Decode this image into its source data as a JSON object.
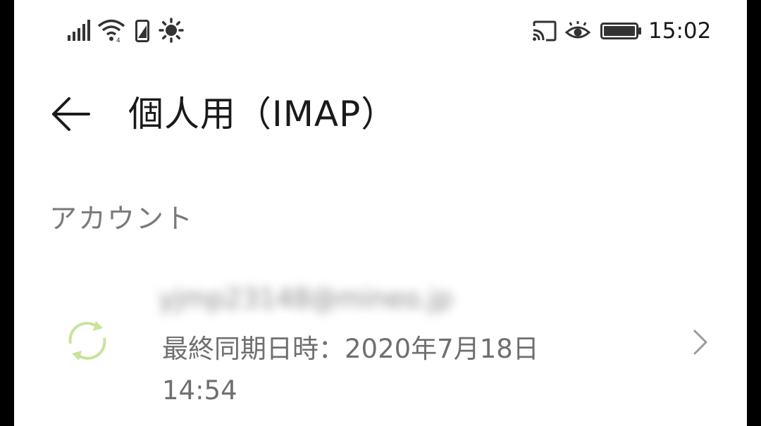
{
  "status_bar": {
    "time": "15:02",
    "icons": [
      "signal-icon",
      "wifi-icon",
      "phone-icon",
      "brightness-icon",
      "cast-icon",
      "eye-comfort-icon",
      "battery-icon"
    ]
  },
  "app_bar": {
    "back_icon": "back-arrow-icon",
    "title": "個人用（IMAP）"
  },
  "section": {
    "header": "アカウント"
  },
  "account": {
    "email": "yjmp23148@mineo.jp",
    "last_sync_label": "最終同期日時：2020年7月18日",
    "last_sync_time": "14:54",
    "sync_icon": "sync-icon",
    "chevron_icon": "chevron-right-icon"
  },
  "colors": {
    "background": "#ffffff",
    "title": "#1a1a1a",
    "secondary": "#7a7a7a",
    "sync_accent": "#c8e39a",
    "frame": "#000000"
  }
}
